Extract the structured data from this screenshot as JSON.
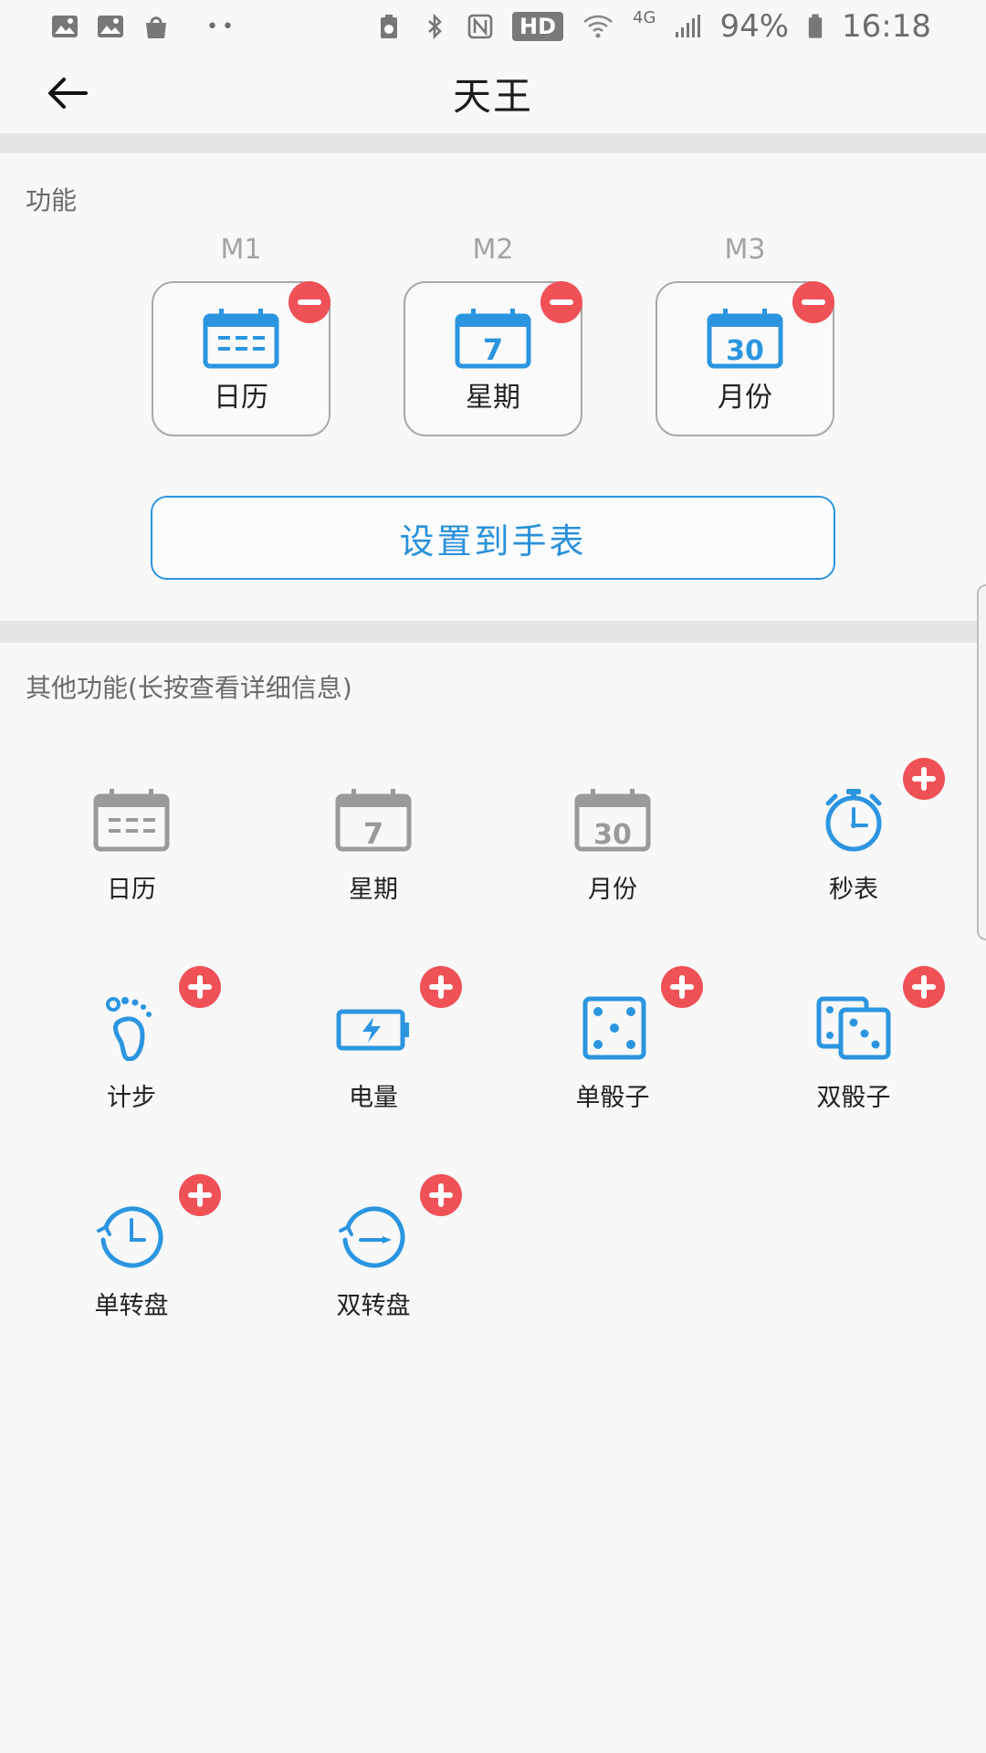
{
  "status_bar": {
    "network_type": "4G",
    "hd_label": "HD",
    "battery_percent": "94%",
    "time": "16:18",
    "more_dots": "••"
  },
  "header": {
    "title": "天王"
  },
  "functions_section": {
    "label": "功能",
    "slots": [
      {
        "tag": "M1",
        "label": "日历",
        "icon": "calendar-icon"
      },
      {
        "tag": "M2",
        "label": "星期",
        "icon": "weekday-icon",
        "icon_text": "7"
      },
      {
        "tag": "M3",
        "label": "月份",
        "icon": "month-icon",
        "icon_text": "30"
      }
    ],
    "set_button_label": "设置到手表"
  },
  "other_section": {
    "label": "其他功能(长按查看详细信息)",
    "items": [
      {
        "label": "日历",
        "icon": "calendar-icon"
      },
      {
        "label": "星期",
        "icon": "weekday-icon",
        "icon_text": "7"
      },
      {
        "label": "月份",
        "icon": "month-icon",
        "icon_text": "30"
      },
      {
        "label": "秒表",
        "icon": "stopwatch-icon"
      },
      {
        "label": "计步",
        "icon": "footprint-icon"
      },
      {
        "label": "电量",
        "icon": "battery-icon"
      },
      {
        "label": "单骰子",
        "icon": "single-dice-icon"
      },
      {
        "label": "双骰子",
        "icon": "double-dice-icon"
      },
      {
        "label": "单转盘",
        "icon": "single-dial-icon"
      },
      {
        "label": "双转盘",
        "icon": "double-dial-icon"
      }
    ]
  },
  "colors": {
    "accent_blue": "#2b95e0",
    "badge_red": "#ef5157",
    "disabled_gray": "#9a9a9a"
  }
}
